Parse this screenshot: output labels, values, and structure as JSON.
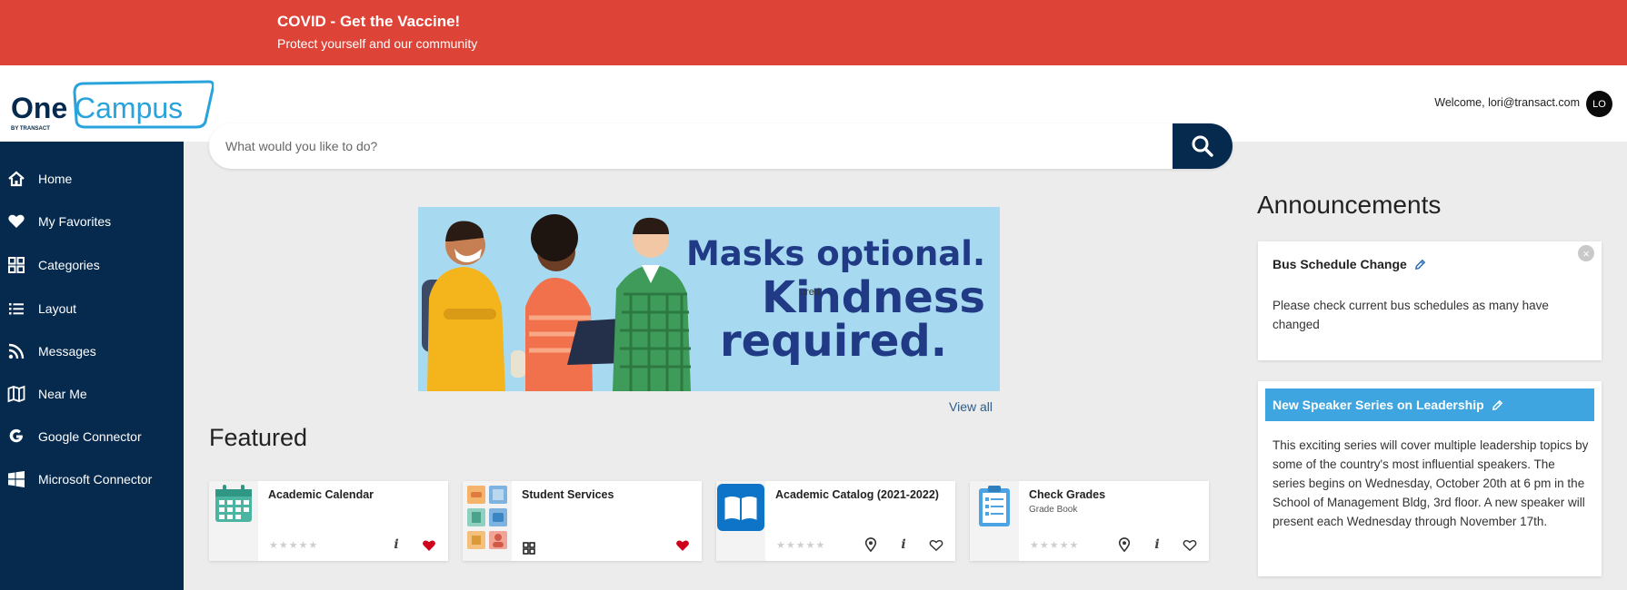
{
  "banner": {
    "title": "COVID - Get the Vaccine!",
    "subtitle": "Protect yourself and our community"
  },
  "header": {
    "logo_text": "OneCampus",
    "logo_byline": "BY TRANSACT",
    "welcome": "Welcome, lori@transact.com",
    "avatar_initials": "LO"
  },
  "sidebar": {
    "items": [
      {
        "label": "Home",
        "icon": "home-icon"
      },
      {
        "label": "My Favorites",
        "icon": "heart-icon"
      },
      {
        "label": "Categories",
        "icon": "grid-icon"
      },
      {
        "label": "Layout",
        "icon": "list-icon"
      },
      {
        "label": "Messages",
        "icon": "rss-icon"
      },
      {
        "label": "Near Me",
        "icon": "map-icon"
      },
      {
        "label": "Google Connector",
        "icon": "google-icon"
      },
      {
        "label": "Microsoft Connector",
        "icon": "windows-icon"
      }
    ]
  },
  "search": {
    "placeholder": "What would you like to do?"
  },
  "hero": {
    "line1": "Masks optional.",
    "line2": "Kindness",
    "line3": "required.",
    "overlay": "ured"
  },
  "view_all": "View all",
  "featured": {
    "title": "Featured",
    "cards": [
      {
        "title": "Academic Calendar",
        "subtitle": "",
        "favorite": true,
        "has_location": false,
        "rating": 0
      },
      {
        "title": "Student Services",
        "subtitle": "",
        "favorite": true,
        "has_location": false,
        "rating": 0
      },
      {
        "title": "Academic Catalog (2021-2022)",
        "subtitle": "",
        "favorite": false,
        "has_location": true,
        "rating": 0
      },
      {
        "title": "Check Grades",
        "subtitle": "Grade Book",
        "favorite": false,
        "has_location": true,
        "rating": 0
      }
    ]
  },
  "announcements": {
    "title": "Announcements",
    "items": [
      {
        "title": "Bus Schedule Change",
        "body": "Please check current bus schedules as many have changed"
      },
      {
        "title": "New Speaker Series on Leadership",
        "body": "This exciting series will cover multiple leadership topics by some of the country's most influential speakers. The series begins on Wednesday, October 20th at 6 pm in the School of Management Bldg, 3rd floor. A new speaker will present each Wednesday through November 17th."
      }
    ]
  },
  "colors": {
    "banner": "#dd4437",
    "sidebar": "#062a4e",
    "accent": "#3fa5e0",
    "favorite": "#d0021b"
  }
}
